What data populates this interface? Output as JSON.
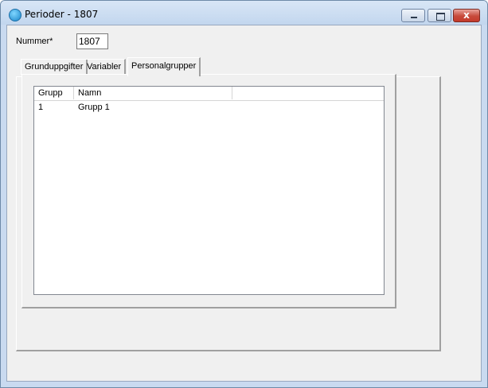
{
  "window": {
    "title": "Perioder - 1807",
    "icon": "app-icon",
    "controls": {
      "minimize": "minimize-icon",
      "maximize": "maximize-icon",
      "close_glyph": "x"
    }
  },
  "form": {
    "nummer_label": "Nummer*",
    "nummer_value": "1807"
  },
  "tabs": [
    {
      "label": "Grunduppgifter"
    },
    {
      "label": "Variabler"
    },
    {
      "label": "Personalgrupper",
      "active": true
    }
  ],
  "grid": {
    "columns": [
      "Grupp",
      "Namn",
      ""
    ],
    "rows": [
      [
        "1",
        "Grupp 1"
      ]
    ]
  }
}
